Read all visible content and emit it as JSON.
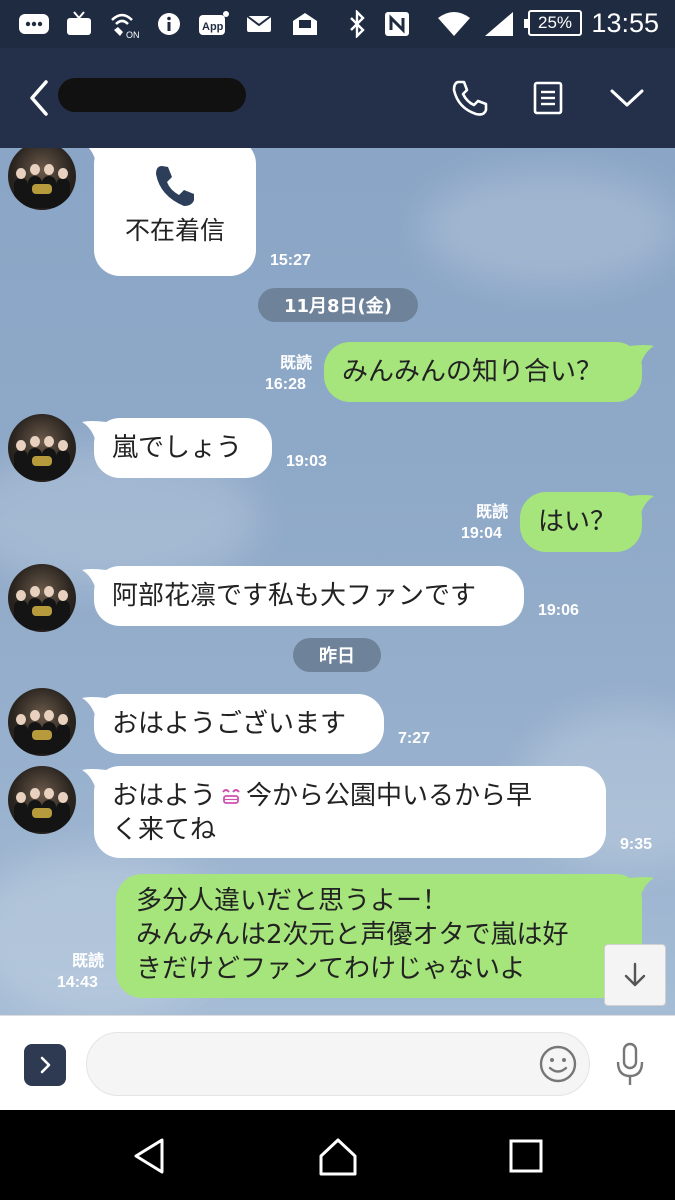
{
  "status_bar": {
    "time": "13:55",
    "battery": "25%",
    "icons": [
      "messenger-icon",
      "tv-icon",
      "wifi-calling-on-icon",
      "info-icon",
      "app-icon",
      "mail-icon",
      "notification-icon",
      "bluetooth-icon",
      "nfc-icon",
      "wifi-icon",
      "signal-icon"
    ],
    "icon_labels": {
      "wifi_calling": "ON",
      "app": "App"
    }
  },
  "header": {
    "contact_name": "",
    "actions": [
      "phone-icon",
      "notes-icon",
      "chevron-down-icon"
    ]
  },
  "chat": {
    "messages": [
      {
        "side": "left",
        "kind": "missed-call",
        "label": "不在着信",
        "time": "15:27"
      },
      {
        "kind": "date",
        "label": "11月8日(金)"
      },
      {
        "side": "right",
        "text": "みんみんの知り合い？",
        "read": "既読",
        "time": "16:28"
      },
      {
        "side": "left",
        "text": "嵐でしょう",
        "time": "19:03"
      },
      {
        "side": "right",
        "text": "はい？",
        "read": "既読",
        "time": "19:04"
      },
      {
        "side": "left",
        "text": "阿部花凛です私も大ファンです",
        "time": "19:06"
      },
      {
        "kind": "date",
        "label": "昨日"
      },
      {
        "side": "left",
        "text": "おはようございます",
        "time": "7:27"
      },
      {
        "side": "left",
        "text_line1_a": "おはよう",
        "text_line1_b": "今から公園中いるから早",
        "text_line2": "く来てね",
        "time": "9:35"
      },
      {
        "side": "right",
        "text_line1": "多分人違いだと思うよー！",
        "text_line2": "みんみんは2次元と声優オタで嵐は好",
        "text_line3": "きだけどファンてわけじゃないよ",
        "read": "既読",
        "time": "14:43"
      }
    ]
  },
  "input": {
    "placeholder": ""
  },
  "colors": {
    "header": "#243049",
    "status_bar": "#1f2b40",
    "my_bubble": "#a5e57b",
    "their_bubble": "#ffffff",
    "chat_background": "#8fa9c8",
    "date_pill": "#6e8299"
  }
}
